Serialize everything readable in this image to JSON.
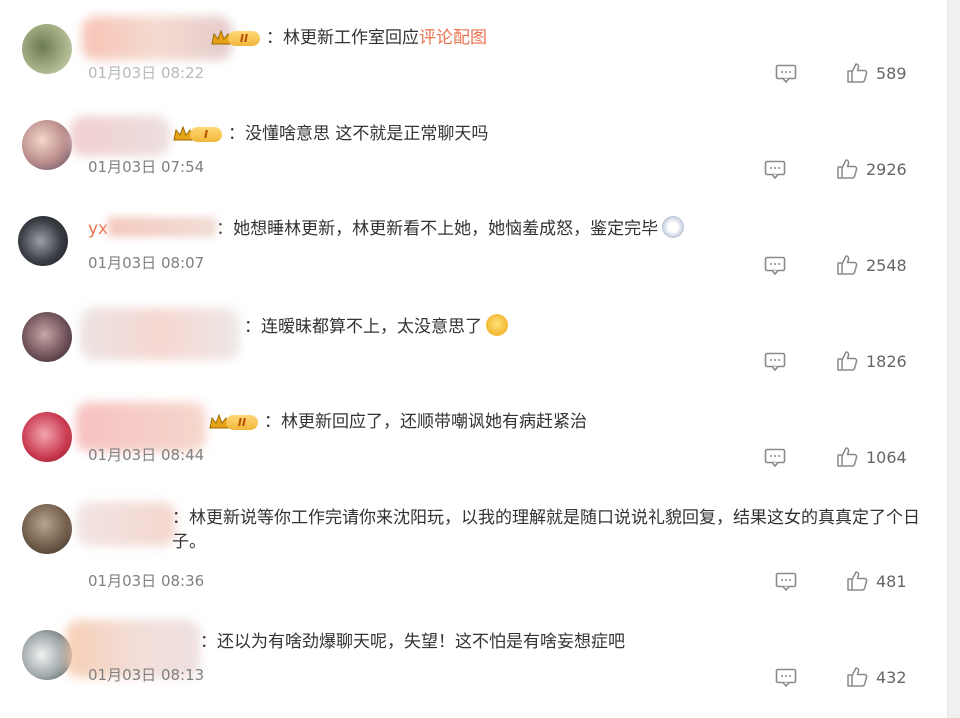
{
  "comments": [
    {
      "username_visible": "",
      "badge_level": "II",
      "text": "：林更新工作室回应",
      "link_text": "评论配图",
      "time": "01月03日 08:22",
      "likes": "589"
    },
    {
      "username_visible": "",
      "badge_level": "I",
      "text": "：没懂啥意思 这不就是正常聊天吗",
      "time": "01月03日 07:54",
      "likes": "2926"
    },
    {
      "username_visible": "yx",
      "text": "：她想睡林更新，林更新看不上她，她恼羞成怒，鉴定完毕",
      "emoji": "crying-face-emoji",
      "time": "01月03日 08:07",
      "likes": "2548"
    },
    {
      "username_visible": "",
      "text": "：连暧昧都算不上，太没意思了",
      "emoji": "laughing-tears-emoji",
      "time": "",
      "likes": "1826"
    },
    {
      "username_visible": "",
      "badge_level": "II",
      "text": "：林更新回应了，还顺带嘲讽她有病赶紧治",
      "time": "01月03日 08:44",
      "likes": "1064"
    },
    {
      "username_visible": "",
      "text": "：林更新说等你工作完请你来沈阳玩，以我的理解就是随口说说礼貌回复，结果这女的真真定了个日子。",
      "time": "01月03日 08:36",
      "likes": "481"
    },
    {
      "username_visible": "",
      "text": "：还以为有啥劲爆聊天呢，失望！这不怕是有啥妄想症吧",
      "time": "01月03日 08:13",
      "likes": "432"
    }
  ],
  "icons": {
    "reply": "comment-icon",
    "like": "thumbs-up-icon",
    "badge": "crown-icon"
  },
  "colors": {
    "link": "#eb7350",
    "text": "#333333",
    "time": "#808080",
    "icon": "#8a8a8a",
    "badge": "#f2b73b"
  }
}
